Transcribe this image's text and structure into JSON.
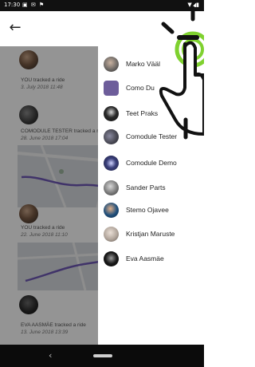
{
  "status_bar": {
    "time": "17:30",
    "icons": "▣ ✉ ⚑",
    "right": "▼◢▮"
  },
  "app_bar": {
    "back_glyph": "←"
  },
  "feed": [
    {
      "text": "YOU tracked a ride",
      "date": "3. July 2018 11:48"
    },
    {
      "text": "COMODULE TESTER tracked a ride",
      "date": "28. June 2018 17:04"
    },
    {
      "text": "YOU tracked a ride",
      "date": "22. June 2018 11:10"
    },
    {
      "text": "EVA AASMÄE tracked a ride",
      "date": "13. June 2018 13:39"
    }
  ],
  "drawer": {
    "items": [
      {
        "name": "Marko Vääl",
        "avatar": "#6f6a66"
      },
      {
        "name": "Como Du",
        "avatar": "#6d5d9a"
      },
      {
        "name": "Teet Praks",
        "avatar": "#2a2a2a"
      },
      {
        "name": "Comodule Tester",
        "avatar": "#4a4a55"
      },
      {
        "name": "Comodule Demo",
        "avatar": "#3a3f7a"
      },
      {
        "name": "Sander Parts",
        "avatar": "#7a7a7a"
      },
      {
        "name": "Stemo Ojavee",
        "avatar": "#1f4e7a"
      },
      {
        "name": "Kristjan Maruste",
        "avatar": "#b0a49a"
      },
      {
        "name": "Eva Aasmäe",
        "avatar": "#1a1a1a"
      }
    ]
  },
  "nav_bar": {
    "back_glyph": "‹"
  },
  "colors": {
    "gesture_accent": "#7fd12f",
    "dim_overlay": "rgba(0,0,0,0.42)"
  }
}
